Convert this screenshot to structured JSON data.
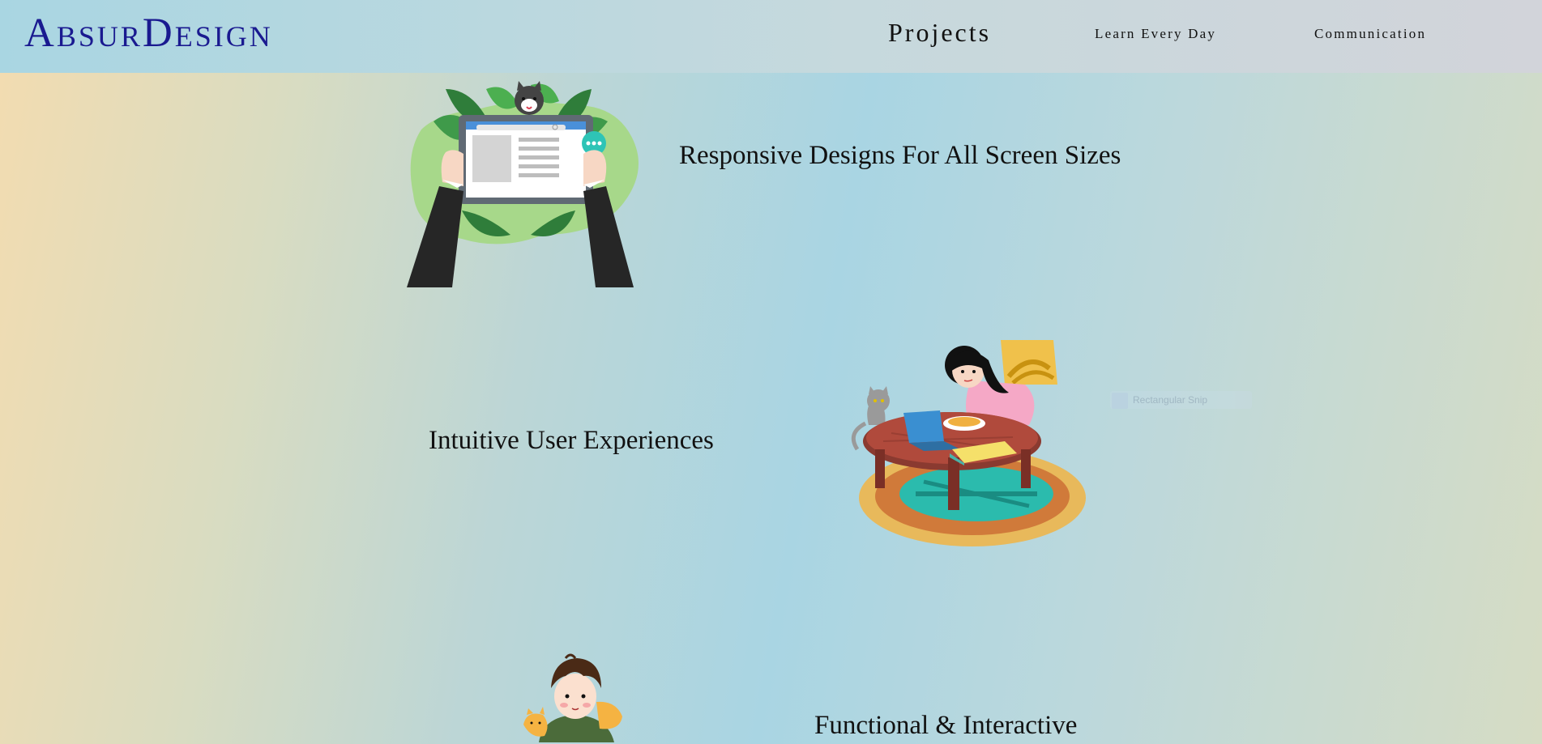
{
  "header": {
    "logo": "AbsurDesign",
    "nav": {
      "projects": "Projects",
      "learn": "Learn Every Day",
      "communication": "Communication"
    }
  },
  "features": [
    {
      "title": "Responsive Designs For All Screen Sizes",
      "icon": "tablet-hands-illustration"
    },
    {
      "title": "Intuitive User Experiences",
      "icon": "girl-laptop-cat-illustration"
    },
    {
      "title": "Functional & Interactive",
      "icon": "boy-cat-illustration"
    }
  ],
  "overlay": {
    "snip_label": "Rectangular Snip"
  },
  "colors": {
    "logo": "#1a1a90",
    "text": "#111111",
    "bg_warm": "#f3dcb0",
    "bg_cool": "#a9d5e3"
  }
}
